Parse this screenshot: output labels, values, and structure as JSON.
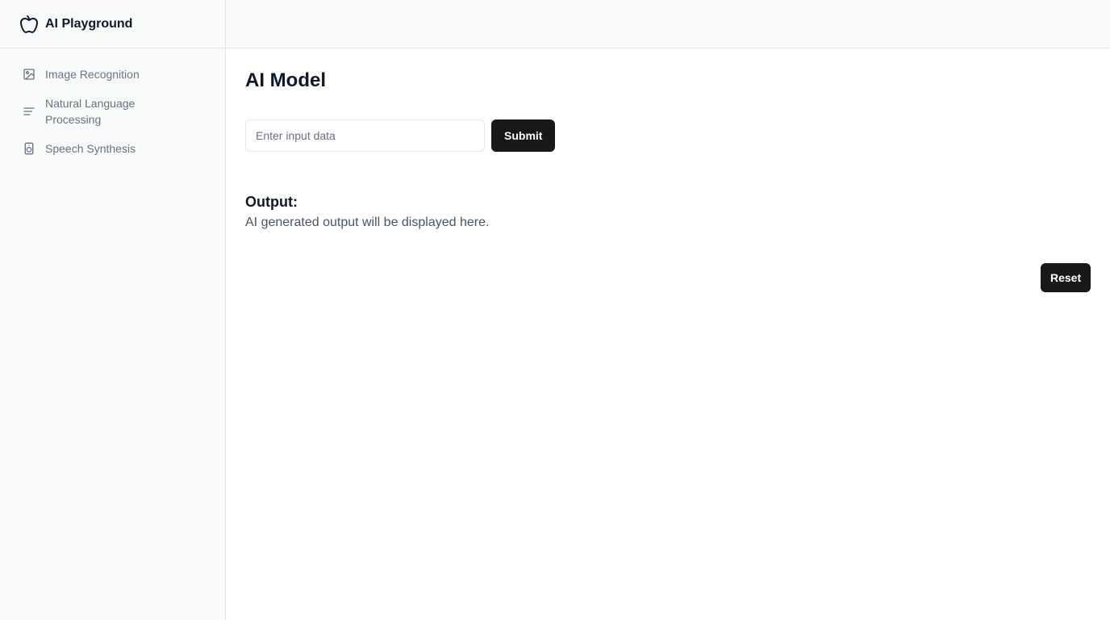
{
  "app": {
    "title": "AI Playground",
    "logo_icon": "apple-icon"
  },
  "sidebar": {
    "items": [
      {
        "label": "Image Recognition",
        "icon": "image-icon"
      },
      {
        "label": "Natural Language Processing",
        "icon": "text-lines-icon"
      },
      {
        "label": "Speech Synthesis",
        "icon": "speaker-icon"
      }
    ]
  },
  "main": {
    "title": "AI Model",
    "input": {
      "placeholder": "Enter input data",
      "value": ""
    },
    "submit_label": "Submit",
    "output": {
      "heading": "Output:",
      "text": "AI generated output will be displayed here."
    },
    "reset_label": "Reset"
  },
  "colors": {
    "primary_button": "#18181b",
    "sidebar_bg": "#f9fafa",
    "muted_text": "#6b7280",
    "border": "#e5e7eb"
  }
}
